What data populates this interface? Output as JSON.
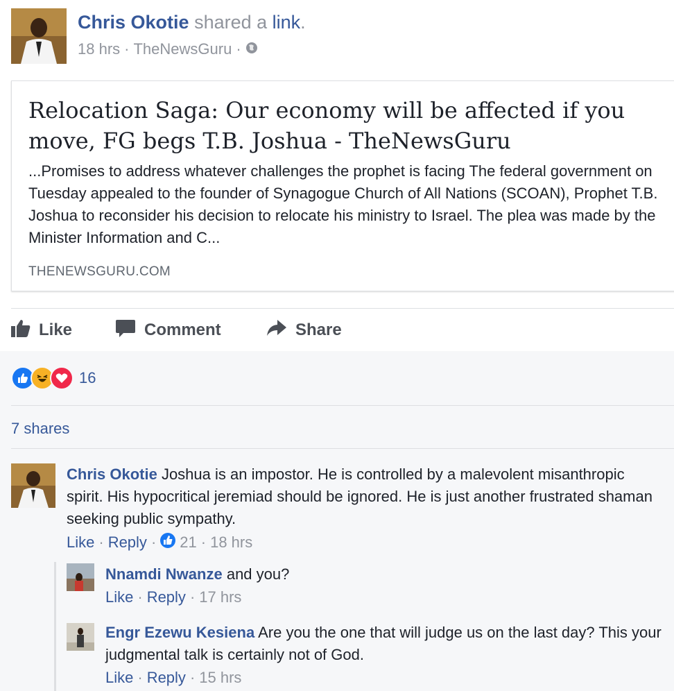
{
  "post": {
    "author": "Chris Okotie",
    "verb": "shared a",
    "link_word": "link",
    "period": ".",
    "time": "18 hrs",
    "source": "TheNewsGuru",
    "dot": "·",
    "privacy_icon": "globe-icon"
  },
  "link_card": {
    "title": "Relocation Saga: Our economy will be affected if you move, FG begs T.B. Joshua - TheNewsGuru",
    "description": "...Promises to address whatever challenges the prophet is facing The federal government on Tuesday appealed to the founder of Synagogue Church of All Nations (SCOAN), Prophet T.B. Joshua to reconsider his decision to relocate his ministry to Israel. The plea was made by the Minister Information and C...",
    "domain": "THENEWSGURU.COM"
  },
  "actions": {
    "like": "Like",
    "comment": "Comment",
    "share": "Share"
  },
  "reactions": {
    "icons": [
      "like-reaction-icon",
      "haha-reaction-icon",
      "love-reaction-icon"
    ],
    "count": "16"
  },
  "shares": "7 shares",
  "comments": [
    {
      "author": "Chris Okotie",
      "text": "Joshua is an impostor. He is controlled by a malevolent misanthropic spirit. His hypocritical jeremiad should be ignored. He is just another frustrated shaman seeking public sympathy.",
      "like": "Like",
      "reply": "Reply",
      "likes": "21",
      "time": "18 hrs"
    }
  ],
  "replies": [
    {
      "author": "Nnamdi Nwanze",
      "text": "and you?",
      "like": "Like",
      "reply": "Reply",
      "time": "17 hrs"
    },
    {
      "author": "Engr Ezewu Kesiena",
      "text": "Are you the one that will judge us on the last day? This your judgmental talk is certainly not of God.",
      "like": "Like",
      "reply": "Reply",
      "time": "15 hrs"
    }
  ],
  "colors": {
    "link_blue": "#365899",
    "muted_gray": "#90949c",
    "like_blue": "#1877f2",
    "love_red": "#f0284a",
    "haha_yellow": "#f7b125"
  }
}
